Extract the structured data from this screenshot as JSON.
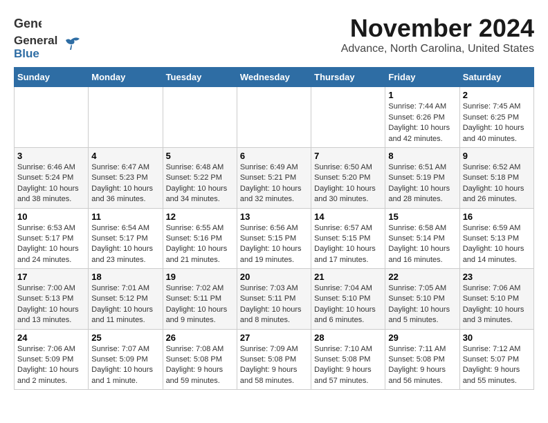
{
  "header": {
    "logo_general": "General",
    "logo_blue": "Blue",
    "month_title": "November 2024",
    "location": "Advance, North Carolina, United States"
  },
  "calendar": {
    "days_of_week": [
      "Sunday",
      "Monday",
      "Tuesday",
      "Wednesday",
      "Thursday",
      "Friday",
      "Saturday"
    ],
    "weeks": [
      [
        {
          "day": "",
          "info": ""
        },
        {
          "day": "",
          "info": ""
        },
        {
          "day": "",
          "info": ""
        },
        {
          "day": "",
          "info": ""
        },
        {
          "day": "",
          "info": ""
        },
        {
          "day": "1",
          "info": "Sunrise: 7:44 AM\nSunset: 6:26 PM\nDaylight: 10 hours and 42 minutes."
        },
        {
          "day": "2",
          "info": "Sunrise: 7:45 AM\nSunset: 6:25 PM\nDaylight: 10 hours and 40 minutes."
        }
      ],
      [
        {
          "day": "3",
          "info": "Sunrise: 6:46 AM\nSunset: 5:24 PM\nDaylight: 10 hours and 38 minutes."
        },
        {
          "day": "4",
          "info": "Sunrise: 6:47 AM\nSunset: 5:23 PM\nDaylight: 10 hours and 36 minutes."
        },
        {
          "day": "5",
          "info": "Sunrise: 6:48 AM\nSunset: 5:22 PM\nDaylight: 10 hours and 34 minutes."
        },
        {
          "day": "6",
          "info": "Sunrise: 6:49 AM\nSunset: 5:21 PM\nDaylight: 10 hours and 32 minutes."
        },
        {
          "day": "7",
          "info": "Sunrise: 6:50 AM\nSunset: 5:20 PM\nDaylight: 10 hours and 30 minutes."
        },
        {
          "day": "8",
          "info": "Sunrise: 6:51 AM\nSunset: 5:19 PM\nDaylight: 10 hours and 28 minutes."
        },
        {
          "day": "9",
          "info": "Sunrise: 6:52 AM\nSunset: 5:18 PM\nDaylight: 10 hours and 26 minutes."
        }
      ],
      [
        {
          "day": "10",
          "info": "Sunrise: 6:53 AM\nSunset: 5:17 PM\nDaylight: 10 hours and 24 minutes."
        },
        {
          "day": "11",
          "info": "Sunrise: 6:54 AM\nSunset: 5:17 PM\nDaylight: 10 hours and 23 minutes."
        },
        {
          "day": "12",
          "info": "Sunrise: 6:55 AM\nSunset: 5:16 PM\nDaylight: 10 hours and 21 minutes."
        },
        {
          "day": "13",
          "info": "Sunrise: 6:56 AM\nSunset: 5:15 PM\nDaylight: 10 hours and 19 minutes."
        },
        {
          "day": "14",
          "info": "Sunrise: 6:57 AM\nSunset: 5:15 PM\nDaylight: 10 hours and 17 minutes."
        },
        {
          "day": "15",
          "info": "Sunrise: 6:58 AM\nSunset: 5:14 PM\nDaylight: 10 hours and 16 minutes."
        },
        {
          "day": "16",
          "info": "Sunrise: 6:59 AM\nSunset: 5:13 PM\nDaylight: 10 hours and 14 minutes."
        }
      ],
      [
        {
          "day": "17",
          "info": "Sunrise: 7:00 AM\nSunset: 5:13 PM\nDaylight: 10 hours and 13 minutes."
        },
        {
          "day": "18",
          "info": "Sunrise: 7:01 AM\nSunset: 5:12 PM\nDaylight: 10 hours and 11 minutes."
        },
        {
          "day": "19",
          "info": "Sunrise: 7:02 AM\nSunset: 5:11 PM\nDaylight: 10 hours and 9 minutes."
        },
        {
          "day": "20",
          "info": "Sunrise: 7:03 AM\nSunset: 5:11 PM\nDaylight: 10 hours and 8 minutes."
        },
        {
          "day": "21",
          "info": "Sunrise: 7:04 AM\nSunset: 5:10 PM\nDaylight: 10 hours and 6 minutes."
        },
        {
          "day": "22",
          "info": "Sunrise: 7:05 AM\nSunset: 5:10 PM\nDaylight: 10 hours and 5 minutes."
        },
        {
          "day": "23",
          "info": "Sunrise: 7:06 AM\nSunset: 5:10 PM\nDaylight: 10 hours and 3 minutes."
        }
      ],
      [
        {
          "day": "24",
          "info": "Sunrise: 7:06 AM\nSunset: 5:09 PM\nDaylight: 10 hours and 2 minutes."
        },
        {
          "day": "25",
          "info": "Sunrise: 7:07 AM\nSunset: 5:09 PM\nDaylight: 10 hours and 1 minute."
        },
        {
          "day": "26",
          "info": "Sunrise: 7:08 AM\nSunset: 5:08 PM\nDaylight: 9 hours and 59 minutes."
        },
        {
          "day": "27",
          "info": "Sunrise: 7:09 AM\nSunset: 5:08 PM\nDaylight: 9 hours and 58 minutes."
        },
        {
          "day": "28",
          "info": "Sunrise: 7:10 AM\nSunset: 5:08 PM\nDaylight: 9 hours and 57 minutes."
        },
        {
          "day": "29",
          "info": "Sunrise: 7:11 AM\nSunset: 5:08 PM\nDaylight: 9 hours and 56 minutes."
        },
        {
          "day": "30",
          "info": "Sunrise: 7:12 AM\nSunset: 5:07 PM\nDaylight: 9 hours and 55 minutes."
        }
      ]
    ]
  }
}
